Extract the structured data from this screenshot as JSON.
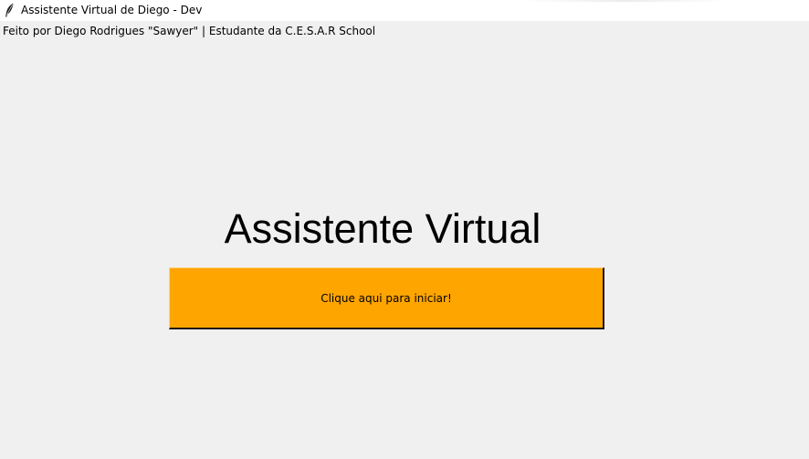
{
  "window": {
    "title": "Assistente Virtual de Diego - Dev"
  },
  "credit": "Feito por Diego Rodrigues \"Sawyer\" | Estudante da C.E.S.A.R School",
  "main": {
    "heading": "Assistente Virtual",
    "start_button_label": "Clique aqui para iniciar!"
  },
  "colors": {
    "background": "#f0f0f0",
    "button": "#ffa500",
    "titlebar": "#ffffff"
  },
  "icons": {
    "app_icon": "feather-icon"
  }
}
